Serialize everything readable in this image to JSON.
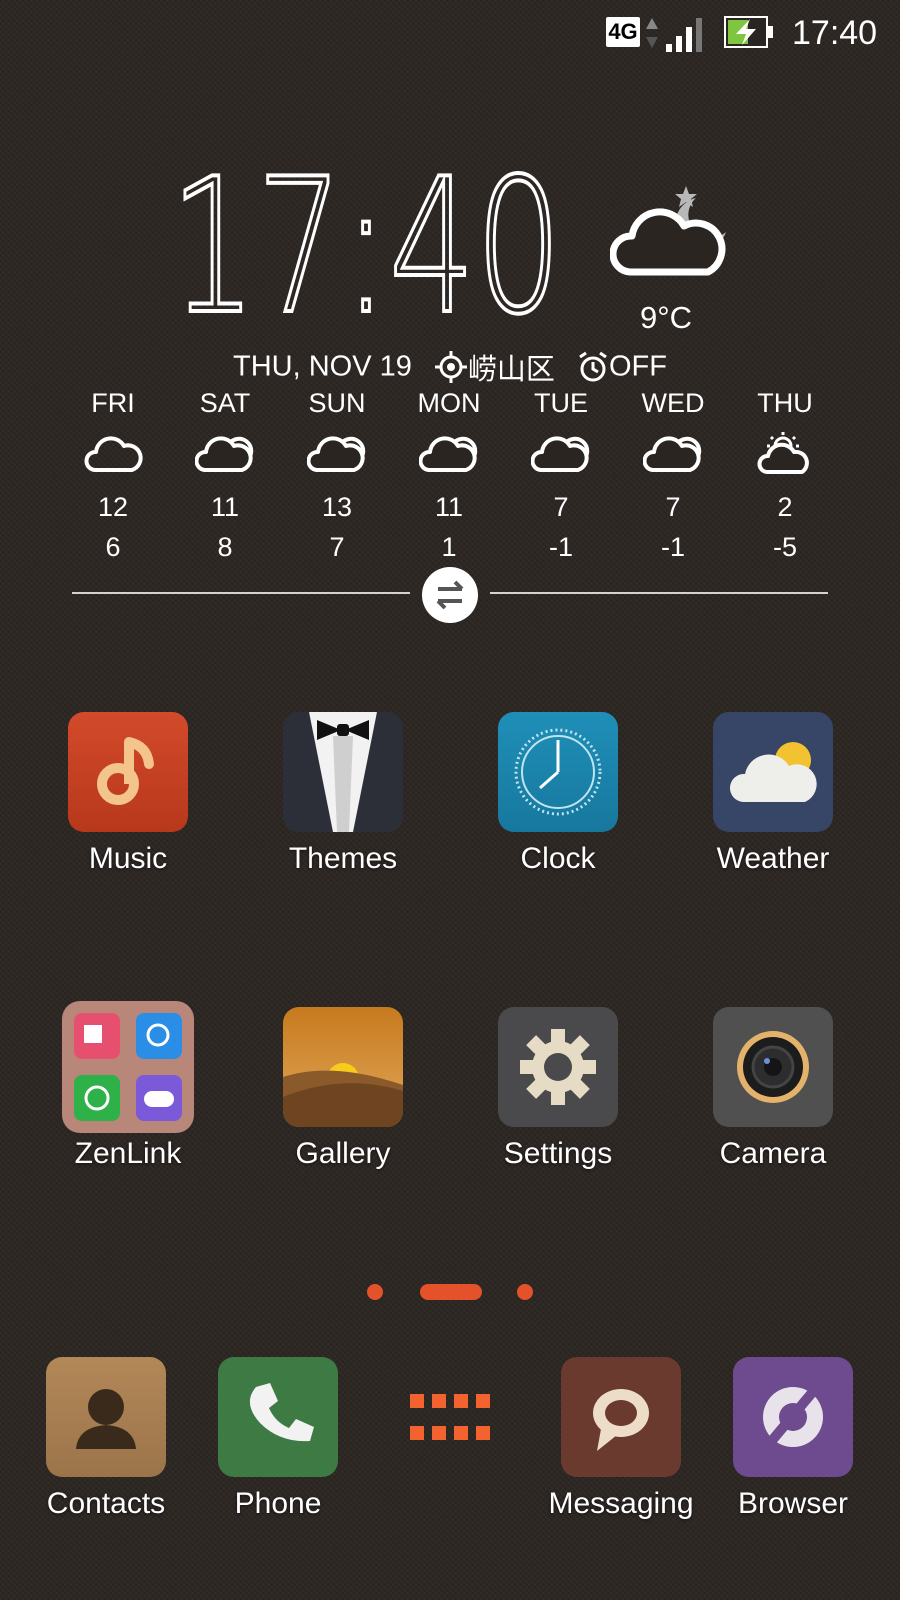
{
  "status_bar": {
    "network": "4G",
    "time": "17:40",
    "icons": [
      "data-arrows-icon",
      "signal-icon",
      "battery-charging-icon"
    ]
  },
  "clock_widget": {
    "time": "17:40",
    "current_weather_icon": "cloudy-night-icon",
    "temperature": "9°C",
    "date": "THU, NOV 19",
    "location": "崂山区",
    "alarm": "OFF"
  },
  "forecast": [
    {
      "day": "FRI",
      "icon": "cloud-icon",
      "high": "12",
      "low": "6"
    },
    {
      "day": "SAT",
      "icon": "partly-cloudy-icon",
      "high": "11",
      "low": "8"
    },
    {
      "day": "SUN",
      "icon": "partly-cloudy-icon",
      "high": "13",
      "low": "7"
    },
    {
      "day": "MON",
      "icon": "partly-cloudy-icon",
      "high": "11",
      "low": "1"
    },
    {
      "day": "TUE",
      "icon": "partly-cloudy-icon",
      "high": "7",
      "low": "-1"
    },
    {
      "day": "WED",
      "icon": "partly-cloudy-icon",
      "high": "7",
      "low": "-1"
    },
    {
      "day": "THU",
      "icon": "sun-cloud-icon",
      "high": "2",
      "low": "-5"
    }
  ],
  "apps": [
    {
      "label": "Music",
      "icon": "music-icon"
    },
    {
      "label": "Themes",
      "icon": "tuxedo-icon"
    },
    {
      "label": "Clock",
      "icon": "clock-icon"
    },
    {
      "label": "Weather",
      "icon": "weather-icon"
    },
    {
      "label": "ZenLink",
      "icon": "folder-icon"
    },
    {
      "label": "Gallery",
      "icon": "gallery-icon"
    },
    {
      "label": "Settings",
      "icon": "gear-icon"
    },
    {
      "label": "Camera",
      "icon": "camera-icon"
    }
  ],
  "pager": {
    "pages": 3,
    "current": 2
  },
  "dock": [
    {
      "label": "Contacts",
      "icon": "contact-icon"
    },
    {
      "label": "Phone",
      "icon": "phone-icon"
    },
    {
      "label": "",
      "icon": "app-drawer-icon"
    },
    {
      "label": "Messaging",
      "icon": "chat-bubble-icon"
    },
    {
      "label": "Browser",
      "icon": "browser-icon"
    }
  ],
  "colors": {
    "accent": "#e4522b",
    "background": "#2b2522"
  }
}
